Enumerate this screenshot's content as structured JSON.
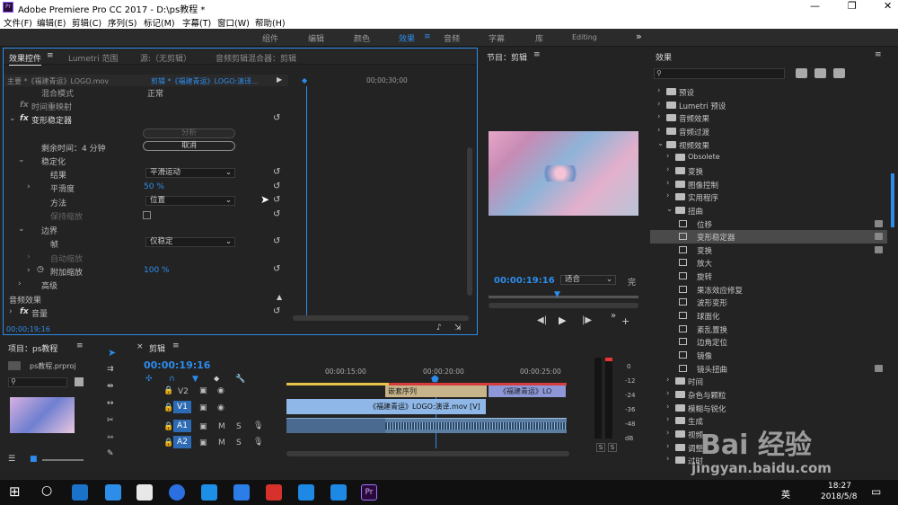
{
  "titlebar": {
    "title": "Adobe Premiere Pro CC 2017 - D:\\ps教程 *",
    "app_icon": "Pr"
  },
  "menu": [
    "文件(F)",
    "编辑(E)",
    "剪辑(C)",
    "序列(S)",
    "标记(M)",
    "字幕(T)",
    "窗口(W)",
    "帮助(H)"
  ],
  "workspaces": [
    "组件",
    "编辑",
    "颜色",
    "效果",
    "音频",
    "字幕",
    "库",
    "Editing"
  ],
  "active_workspace": "效果",
  "ec": {
    "tabs": [
      "效果控件",
      "Lumetri 范围",
      "源:（无剪辑）",
      "音频剪辑混合器：剪辑"
    ],
    "master": "主要 *《福建青运》LOGO.mov",
    "seq": "剪辑 *《福建青运》LOGO:演译...",
    "ruler_time": "00;00;30;00",
    "rows": {
      "blend": "混合模式",
      "blend_val": "正常",
      "remap": "时间重映射",
      "warp": "变形稳定器",
      "analyze": "分析",
      "remaining": "剩余时间：4 分钟",
      "cancel": "取消",
      "stab": "稳定化",
      "result": "结果",
      "result_val": "平滑运动",
      "smooth": "平滑度",
      "smooth_val": "50 %",
      "method": "方法",
      "method_val": "位置",
      "keepscale": "保持缩放",
      "border": "边界",
      "framing": "帧",
      "framing_val": "仅稳定",
      "autoscale": "自动缩放",
      "addscale": "附加缩放",
      "addscale_val": "100 %",
      "advanced": "高级",
      "audio_fx": "音频效果",
      "volume": "音量"
    },
    "timecode": "00;00;19;16"
  },
  "program": {
    "title": "节目：剪辑",
    "timecode": "00:00:19:16",
    "fit": "适合",
    "full": "完"
  },
  "effects": {
    "title": "效果",
    "search_placeholder": "",
    "tree": [
      {
        "label": "预设",
        "kind": "folder",
        "depth": 0
      },
      {
        "label": "Lumetri 预设",
        "kind": "folder",
        "depth": 0
      },
      {
        "label": "音频效果",
        "kind": "folder",
        "depth": 0
      },
      {
        "label": "音频过渡",
        "kind": "folder",
        "depth": 0
      },
      {
        "label": "视频效果",
        "kind": "folder",
        "depth": 0,
        "open": true
      },
      {
        "label": "Obsolete",
        "kind": "folder",
        "depth": 1
      },
      {
        "label": "变换",
        "kind": "folder",
        "depth": 1
      },
      {
        "label": "图像控制",
        "kind": "folder",
        "depth": 1
      },
      {
        "label": "实用程序",
        "kind": "folder",
        "depth": 1
      },
      {
        "label": "扭曲",
        "kind": "folder",
        "depth": 1,
        "open": true
      },
      {
        "label": "位移",
        "kind": "fx",
        "depth": 2,
        "badge": true
      },
      {
        "label": "变形稳定器",
        "kind": "fx",
        "depth": 2,
        "badge": true,
        "selected": true
      },
      {
        "label": "变换",
        "kind": "fx",
        "depth": 2,
        "badge": true
      },
      {
        "label": "放大",
        "kind": "fx",
        "depth": 2
      },
      {
        "label": "旋转",
        "kind": "fx",
        "depth": 2
      },
      {
        "label": "果冻效应修复",
        "kind": "fx",
        "depth": 2
      },
      {
        "label": "波形变形",
        "kind": "fx",
        "depth": 2
      },
      {
        "label": "球面化",
        "kind": "fx",
        "depth": 2
      },
      {
        "label": "紊乱置换",
        "kind": "fx",
        "depth": 2
      },
      {
        "label": "边角定位",
        "kind": "fx",
        "depth": 2
      },
      {
        "label": "镜像",
        "kind": "fx",
        "depth": 2
      },
      {
        "label": "镜头扭曲",
        "kind": "fx",
        "depth": 2,
        "badge": true
      },
      {
        "label": "时间",
        "kind": "folder",
        "depth": 1
      },
      {
        "label": "杂色与颗粒",
        "kind": "folder",
        "depth": 1
      },
      {
        "label": "模糊与锐化",
        "kind": "folder",
        "depth": 1
      },
      {
        "label": "生成",
        "kind": "folder",
        "depth": 1
      },
      {
        "label": "视频",
        "kind": "folder",
        "depth": 1
      },
      {
        "label": "调整",
        "kind": "folder",
        "depth": 1
      },
      {
        "label": "过时",
        "kind": "folder",
        "depth": 1
      }
    ]
  },
  "project": {
    "title": "项目：ps教程",
    "file": "ps教程.prproj"
  },
  "timeline": {
    "tab": "剪辑",
    "timecode": "00:00:19:16",
    "ticks": [
      "00:00:15:00",
      "00:00:20:00",
      "00:00:25:00"
    ],
    "tracks": [
      "V2",
      "V1",
      "A1",
      "A2"
    ],
    "clip_v1": "《福建青运》LOGO:演译.mov [V]",
    "clip_v2a": "嵌套序列",
    "clip_v2b": "《福建青运》LO"
  },
  "meter": {
    "labels": [
      "0",
      "-12",
      "-24",
      "-36",
      "-48",
      "dB"
    ],
    "solo": [
      "S",
      "S"
    ]
  },
  "taskbar": {
    "time": "18:27",
    "date": "2018/5/8",
    "ime": "英"
  },
  "watermark": {
    "brand": "Bai 经验",
    "url": "jingyan.baidu.com"
  }
}
